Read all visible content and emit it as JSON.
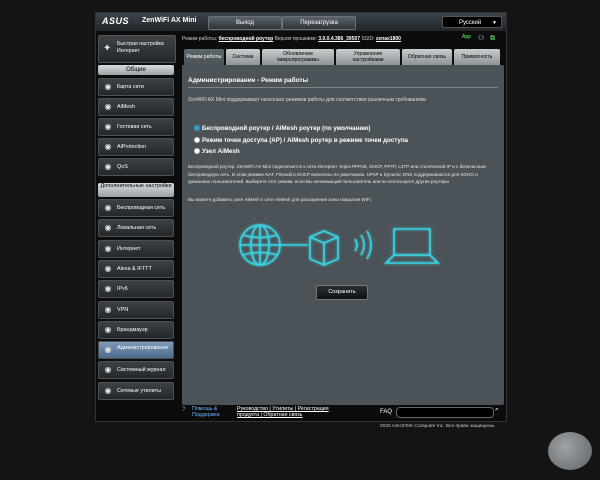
{
  "header": {
    "logo": "ASUS",
    "model": "ZenWiFi AX Mini",
    "logout_label": "Выход",
    "reboot_label": "Перезагрузка",
    "language": "Русский"
  },
  "info_bar": {
    "mode_label": "Режим работы:",
    "mode_value": "беспроводной роутер",
    "fw_label": "Версия прошивки:",
    "fw_value": "3.0.0.4.386_39507",
    "ssid_label": "SSID:",
    "ssid_value": "zenax1800",
    "app_label": "App"
  },
  "sidebar": {
    "quick_setup": "Быстрая настройка Интернет",
    "general_header": "Общие",
    "general_items": [
      {
        "label": "Карта сети",
        "icon": "network-map-icon"
      },
      {
        "label": "AiMesh",
        "icon": "aimesh-icon"
      },
      {
        "label": "Гостевая сеть",
        "icon": "guest-network-icon"
      },
      {
        "label": "AiProtection",
        "icon": "aiprotection-icon"
      },
      {
        "label": "QoS",
        "icon": "qos-icon"
      }
    ],
    "advanced_header": "Дополнительные настройки",
    "advanced_items": [
      {
        "label": "Беспроводная сеть",
        "icon": "wireless-icon"
      },
      {
        "label": "Локальная сеть",
        "icon": "lan-icon"
      },
      {
        "label": "Интернет",
        "icon": "internet-icon"
      },
      {
        "label": "Alexa & IFTTT",
        "icon": "alexa-icon"
      },
      {
        "label": "IPv6",
        "icon": "ipv6-icon"
      },
      {
        "label": "VPN",
        "icon": "vpn-icon"
      },
      {
        "label": "Брандмауэр",
        "icon": "firewall-icon"
      },
      {
        "label": "Администрирование",
        "icon": "administration-icon"
      },
      {
        "label": "Системный журнал",
        "icon": "system-log-icon"
      },
      {
        "label": "Сетевые утилиты",
        "icon": "network-tools-icon"
      }
    ]
  },
  "tabs": [
    {
      "label": "Режим работы"
    },
    {
      "label": "Система"
    },
    {
      "label": "Обновление микропрограммы"
    },
    {
      "label": "Управление настройками"
    },
    {
      "label": "Обратная связь"
    },
    {
      "label": "Приватность"
    }
  ],
  "content": {
    "title": "Администрирование - Режим работы",
    "description": "ZenWiFi AX Mini поддерживает несколько режимов работы для соответствия различным требованиям",
    "options": [
      {
        "label": "Беспроводной роутер / AiMesh роутер (по умолчанию)",
        "selected": true
      },
      {
        "label": "Режим точки доступа (AP) / AiMesh роутер в режиме точки доступа",
        "selected": false
      },
      {
        "label": "Узел AiMesh",
        "selected": false
      }
    ],
    "paragraph": "Беспроводной роутер. ZenWiFi AX Mini подключается к сети Интернет через PPPoE, DHCP, PPTP, L2TP или статический IP и с безопасным беспроводную сеть. В этом режиме NAT, Firewall и DHCP включены по умолчанию. UPnP и Dynamic DNS поддерживаются для SOHO и домашних пользователей. Выберите этот режим, если Вы начинающий пользователь или не используете другие роутеры",
    "paragraph2": "Вы можете добавить узел AiMesh к сети AiMesh для расширения зоны покрытия WiFi.",
    "save_label": "Сохранить"
  },
  "footer": {
    "help_label": "Помощь & Поддержка",
    "links": "Руководство | Утилиты | Регистрация продукта | Обратная связь",
    "faq_label": "FAQ",
    "copyright": "2020 ASUSTeK Computer Inc. Все права защищены."
  },
  "colors": {
    "accent": "#33ccdd",
    "sidebar_active": "#6f8cab",
    "content_bg": "#4b5358"
  }
}
